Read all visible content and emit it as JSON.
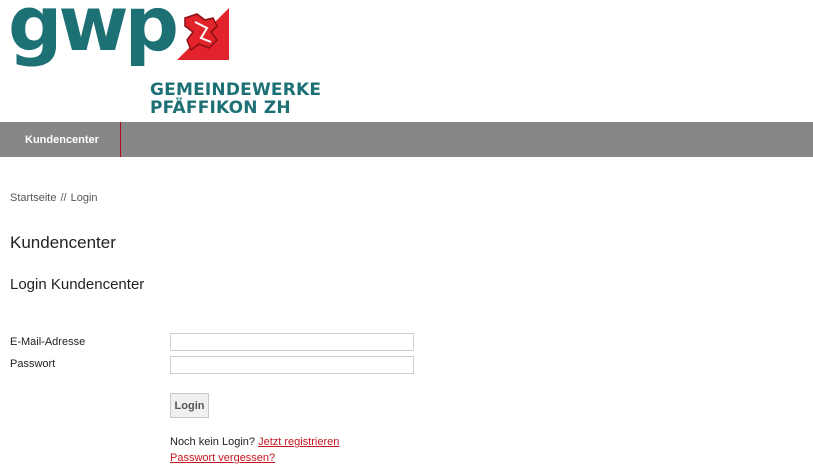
{
  "brand": {
    "logo_text": "gwp",
    "name_line1": "GEMEINDEWERKE",
    "name_line2": "PFÄFFIKON ZH",
    "color_primary": "#1d7175",
    "color_accent": "#c6161f",
    "crest_icon": "coat-of-arms-icon"
  },
  "nav": {
    "items": [
      {
        "label": "Kundencenter"
      }
    ],
    "background": "#878787"
  },
  "breadcrumb": {
    "home": "Startseite",
    "separator": "//",
    "current": "Login"
  },
  "main": {
    "title": "Kundencenter",
    "subtitle": "Login Kundencenter"
  },
  "form": {
    "email_label": "E-Mail-Adresse",
    "email_value": "",
    "password_label": "Passwort",
    "password_value": "",
    "submit_label": "Login",
    "no_login_text": "Noch kein Login?",
    "register_link": "Jetzt registrieren",
    "forgot_link": "Passwort vergessen?"
  }
}
